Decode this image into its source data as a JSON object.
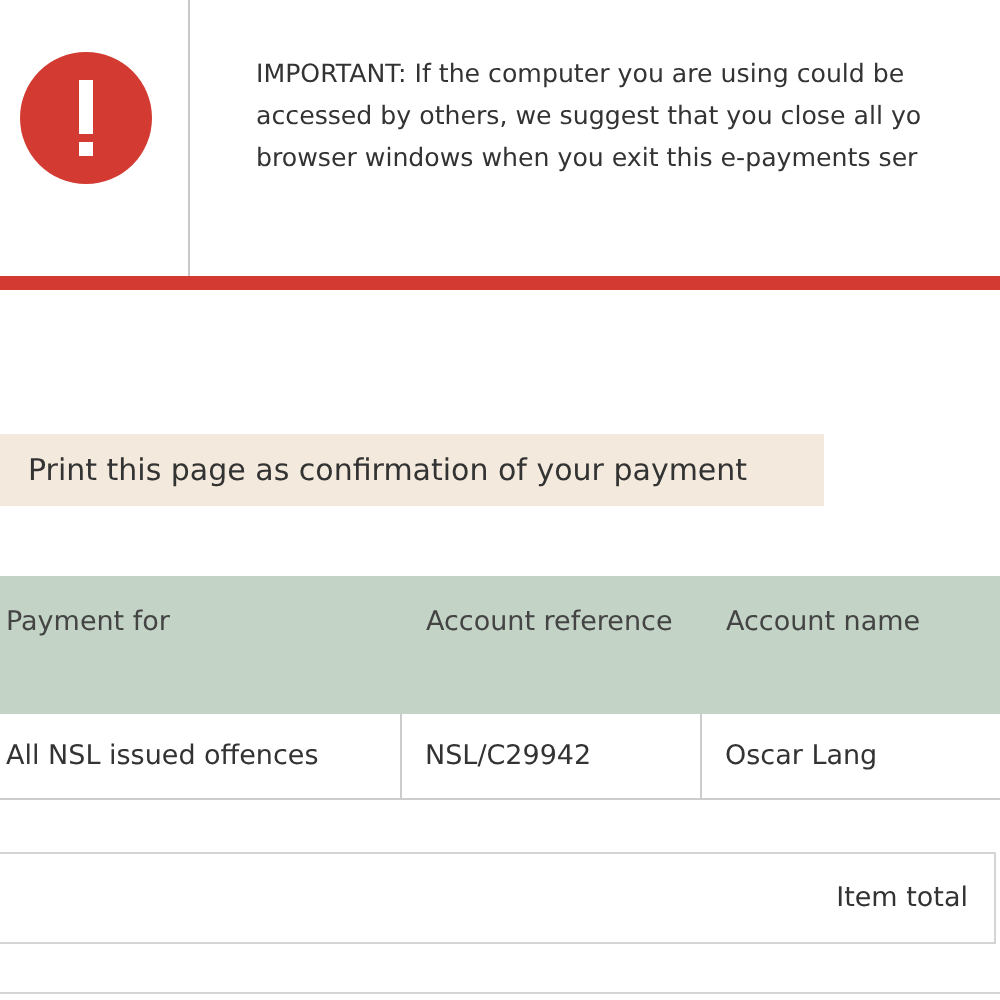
{
  "notice": {
    "lines": [
      "IMPORTANT: If the computer you are using could be",
      "accessed by others, we suggest that you close all yo",
      "browser windows when you exit this e-payments ser"
    ]
  },
  "print_banner": "Print this page as confirmation of your payment",
  "table": {
    "columns": [
      "Payment for",
      "Account reference",
      "Account name"
    ],
    "rows": [
      [
        "All NSL issued offences",
        "NSL/C29942",
        "Oscar Lang"
      ]
    ]
  },
  "summary": {
    "label": "Item total"
  }
}
